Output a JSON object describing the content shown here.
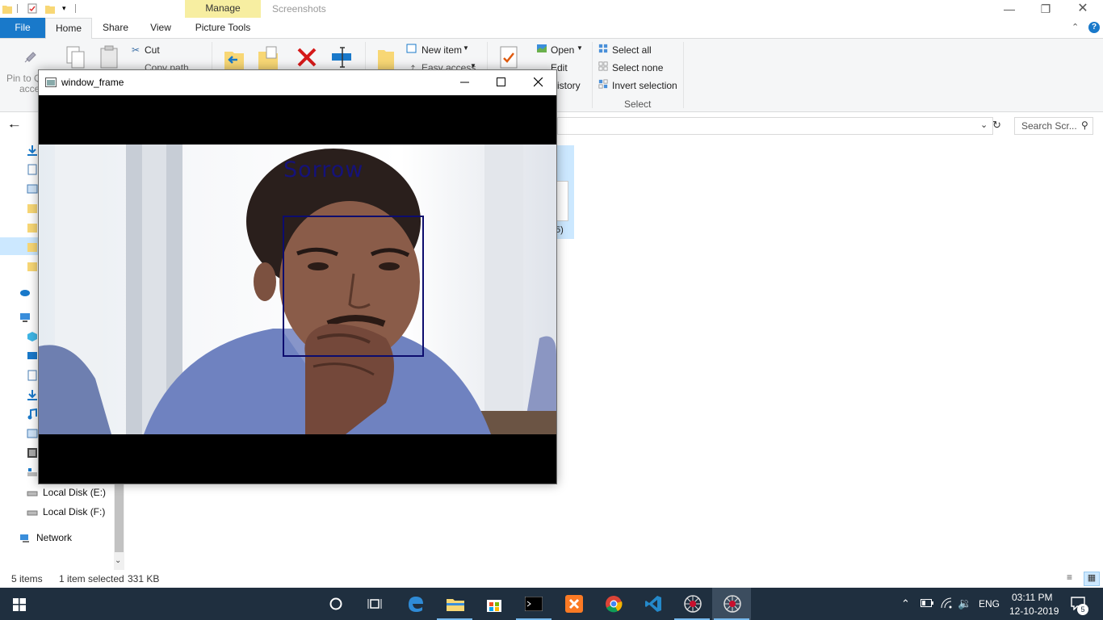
{
  "explorer": {
    "title": "Screenshots",
    "context_tab": "Manage",
    "tabs": [
      "File",
      "Home",
      "Share",
      "View",
      "Picture Tools"
    ],
    "ribbon": {
      "pin_label_1": "Pin to Q",
      "pin_label_2": "acce",
      "cut": "Cut",
      "copy_path": "Copy path",
      "new_item": "New item",
      "easy_access": "Easy access",
      "open": "Open",
      "edit": "Edit",
      "history": "istory",
      "select_all": "Select all",
      "select_none": "Select none",
      "invert_selection": "Invert selection",
      "select_group": "Select"
    },
    "search_placeholder": "Search Scr...",
    "nav": {
      "local_disk_e": "Local Disk (E:)",
      "local_disk_f": "Local Disk (F:)",
      "network": "Network"
    },
    "file_fragment": "5)",
    "status": {
      "items": "5 items",
      "selected": "1 item selected",
      "size": "331 KB"
    }
  },
  "cv_window": {
    "title": "window_frame",
    "emotion_label": "Sorrow"
  },
  "taskbar": {
    "language": "ENG",
    "time": "03:11 PM",
    "date": "12-10-2019",
    "notification_count": "5"
  },
  "colors": {
    "file_tab": "#1979ca",
    "manage_tab": "#f7eea1",
    "taskbar": "#1f2f3f",
    "face_box": "#0c0c6e",
    "emotion_text": "#15127a"
  }
}
